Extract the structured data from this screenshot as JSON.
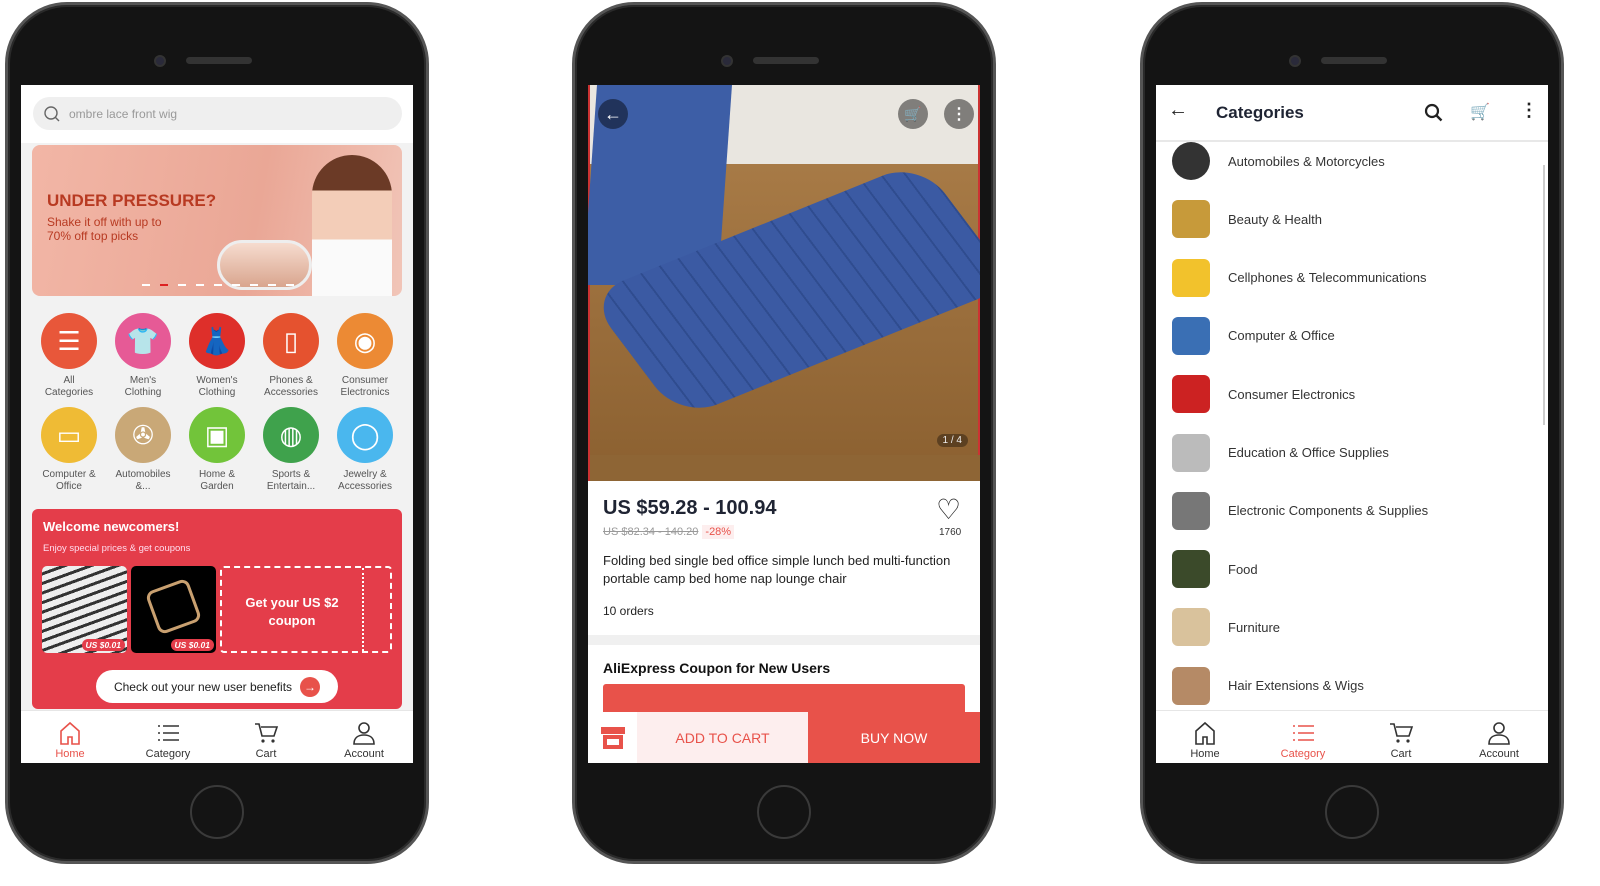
{
  "home": {
    "search_placeholder": "ombre lace front wig",
    "banner": {
      "title": "UNDER PRESSURE?",
      "subtitle_1": "Shake it off with up to",
      "subtitle_2": "70% off top picks"
    },
    "categories": [
      {
        "label_1": "All",
        "label_2": "Categories",
        "color": "#e8573a",
        "icon": "list-icon"
      },
      {
        "label_1": "Men's",
        "label_2": "Clothing",
        "color": "#e65a96",
        "icon": "tshirt-icon"
      },
      {
        "label_1": "Women's",
        "label_2": "Clothing",
        "color": "#de2f2a",
        "icon": "dress-icon"
      },
      {
        "label_1": "Phones &",
        "label_2": "Accessories",
        "color": "#e5522f",
        "icon": "phone-icon"
      },
      {
        "label_1": "Consumer",
        "label_2": "Electronics",
        "color": "#ec8a34",
        "icon": "camera-icon"
      },
      {
        "label_1": "Computer &",
        "label_2": "Office",
        "color": "#efbb35",
        "icon": "laptop-icon"
      },
      {
        "label_1": "Automobiles",
        "label_2": "&...",
        "color": "#c9a877",
        "icon": "wheel-icon"
      },
      {
        "label_1": "Home &",
        "label_2": "Garden",
        "color": "#72c43a",
        "icon": "armchair-icon"
      },
      {
        "label_1": "Sports &",
        "label_2": "Entertain...",
        "color": "#3fa24c",
        "icon": "basketball-icon"
      },
      {
        "label_1": "Jewelry &",
        "label_2": "Accessories",
        "color": "#4ab7ee",
        "icon": "ring-icon"
      }
    ],
    "welcome": {
      "title": "Welcome newcomers!",
      "subtitle": "Enjoy special prices & get coupons",
      "price_1": "US $0.01",
      "price_2": "US $0.01",
      "coupon_1": "Get your US $2",
      "coupon_2": "coupon",
      "cta": "Check out your new user benefits"
    },
    "nav": [
      "Home",
      "Category",
      "Cart",
      "Account"
    ],
    "active_nav": "Home"
  },
  "product": {
    "image_counter": "1 / 4",
    "price": "US $59.28 - 100.94",
    "original_price": "US $82.34 - 140.20",
    "discount": "-28%",
    "wishlist_count": "1760",
    "title": "Folding bed single bed office simple lunch bed multi-function portable camp bed home nap lounge chair",
    "orders": "10 orders",
    "coupon_title": "AliExpress Coupon for New Users",
    "add_to_cart": "ADD TO CART",
    "buy_now": "BUY NOW"
  },
  "categories_page": {
    "title": "Categories",
    "items": [
      "Automobiles & Motorcycles",
      "Beauty & Health",
      "Cellphones & Telecommunications",
      "Computer & Office",
      "Consumer Electronics",
      "Education & Office Supplies",
      "Electronic Components & Supplies",
      "Food",
      "Furniture",
      "Hair Extensions & Wigs"
    ],
    "nav": [
      "Home",
      "Category",
      "Cart",
      "Account"
    ],
    "active_nav": "Category"
  },
  "colors": {
    "accent": "#e8524a",
    "welcome_bg": "#e43d4a"
  }
}
